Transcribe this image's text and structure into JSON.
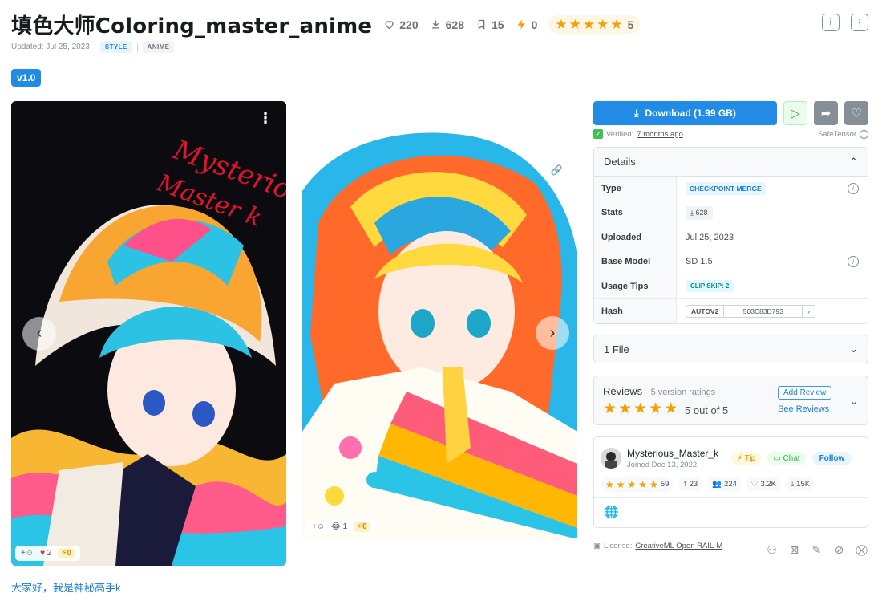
{
  "header": {
    "title": "填色大师Coloring_master_anime",
    "likes": "220",
    "downloads": "628",
    "bookmarks": "15",
    "buzz": "0",
    "rating_count": "5",
    "updated": "Updated: Jul 25, 2023",
    "tags": [
      "STYLE",
      "ANIME"
    ]
  },
  "version": {
    "label": "v1.0"
  },
  "gallery": {
    "image1": {
      "overlay_text": "Mysterious Master k",
      "reactions": {
        "heart": "2",
        "buzz": "0"
      }
    },
    "image2": {
      "reactions": {
        "laugh": "1",
        "buzz": "0"
      }
    }
  },
  "description": "大家好，我是神秘高手k",
  "sidebar": {
    "download_label": "Download (1.99 GB)",
    "verified_label": "Verified:",
    "verified_time": "7 months ago",
    "format": "SafeTensor",
    "details_title": "Details",
    "details": [
      {
        "key": "Type",
        "value": "CHECKPOINT MERGE"
      },
      {
        "key": "Stats",
        "value": "628"
      },
      {
        "key": "Uploaded",
        "value": "Jul 25, 2023"
      },
      {
        "key": "Base Model",
        "value": "SD 1.5"
      },
      {
        "key": "Usage Tips",
        "value": "CLIP SKIP: 2"
      },
      {
        "key": "Hash",
        "hash_type": "AUTOV2",
        "value": "503C83D793"
      }
    ],
    "files_label": "1 File",
    "reviews": {
      "label": "Reviews",
      "sub": "5 version ratings",
      "score": "5 out of 5",
      "add_label": "Add Review",
      "see_label": "See Reviews"
    },
    "creator": {
      "name": "Mysterious_Master_k",
      "joined": "Joined Dec 13, 2022",
      "tip_label": "Tip",
      "chat_label": "Chat",
      "follow_label": "Follow",
      "rating_count": "59",
      "uploads": "23",
      "followers": "224",
      "likes": "3.2K",
      "downloads": "15K"
    },
    "license_label": "License:",
    "license_name": "CreativeML Open RAIL-M"
  },
  "colors": {
    "accent": "#228be6",
    "star": "#f59f00"
  }
}
